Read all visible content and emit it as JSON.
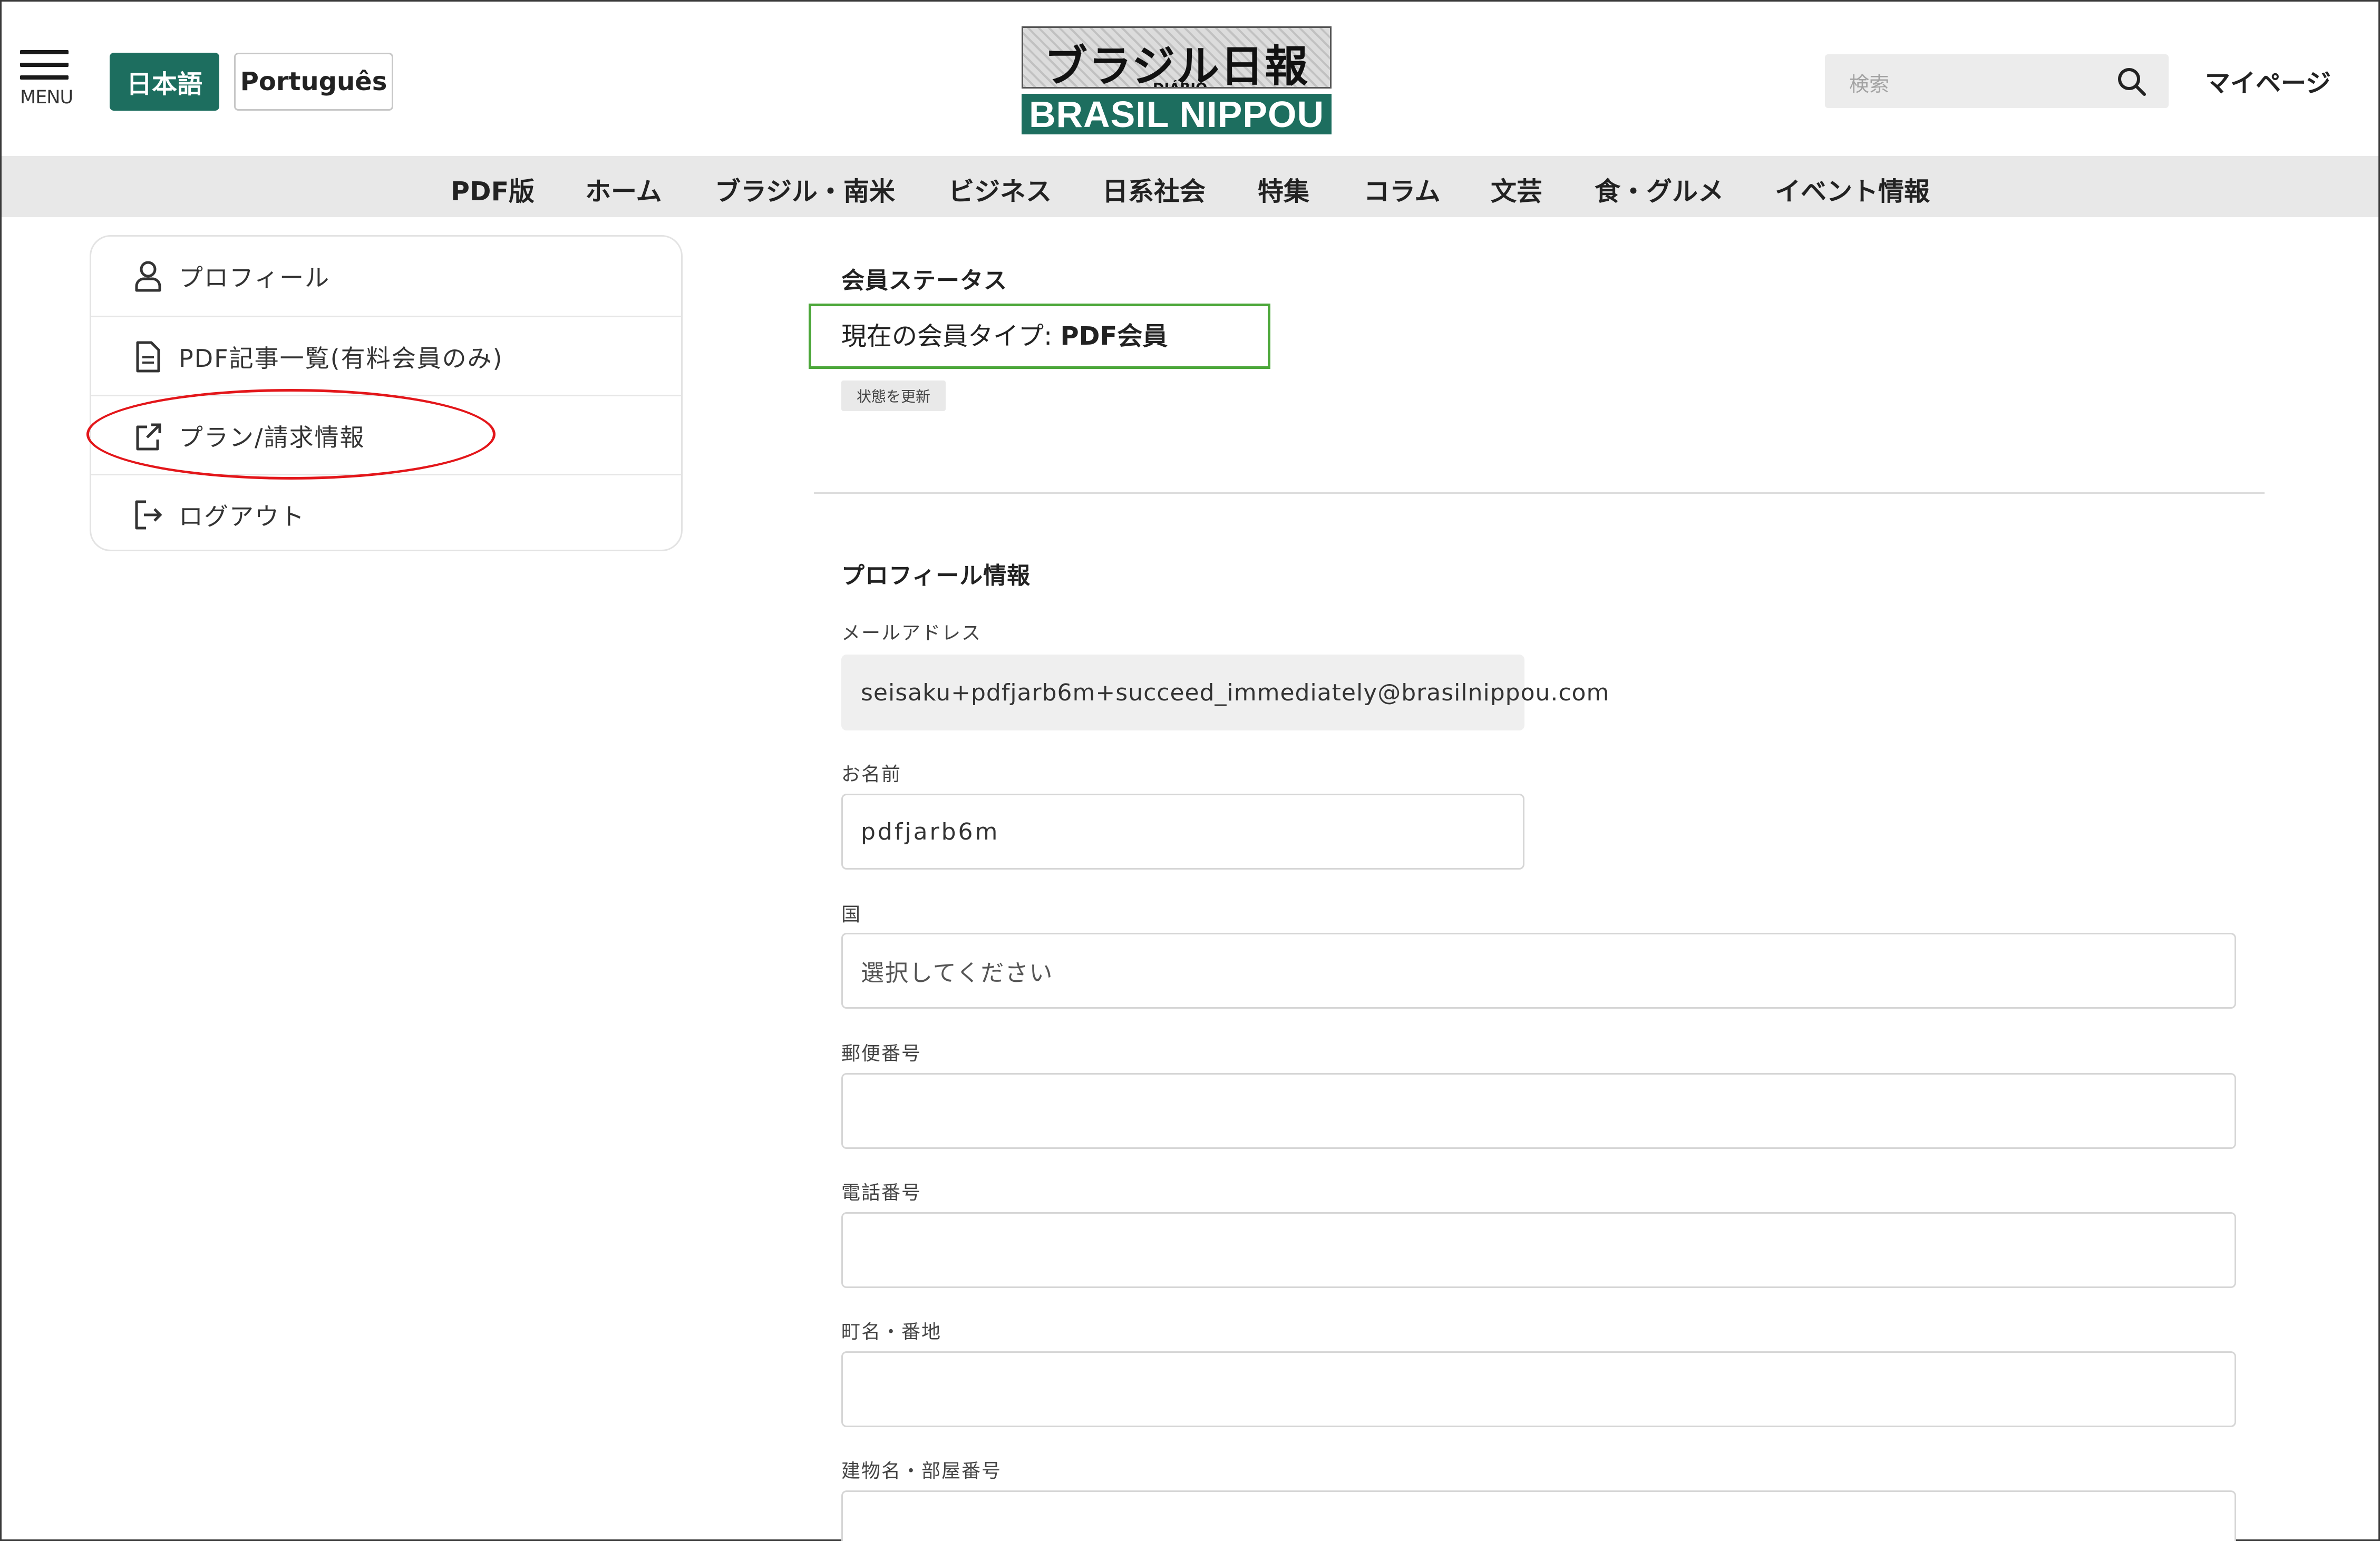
{
  "header": {
    "menu_label": "MENU",
    "lang_ja": "日本語",
    "lang_pt": "Português",
    "logo_jp": "ブラジル日報",
    "logo_diario": "DIÁRIO",
    "logo_en": "BRASIL NIPPOU",
    "search_placeholder": "検索",
    "mypage": "マイページ"
  },
  "nav": {
    "items": [
      "PDF版",
      "ホーム",
      "ブラジル・南米",
      "ビジネス",
      "日系社会",
      "特集",
      "コラム",
      "文芸",
      "食・グルメ",
      "イベント情報"
    ]
  },
  "sidebar": {
    "items": [
      {
        "label": "プロフィール",
        "icon": "user-icon"
      },
      {
        "label": "PDF記事一覧(有料会員のみ)",
        "icon": "document-icon"
      },
      {
        "label": "プラン/請求情報",
        "icon": "external-link-icon"
      },
      {
        "label": "ログアウト",
        "icon": "logout-icon"
      }
    ]
  },
  "status": {
    "title": "会員ステータス",
    "member_prefix": "現在の会員タイプ: ",
    "member_type": "PDF会員",
    "refresh_label": "状態を更新"
  },
  "profile": {
    "title": "プロフィール情報",
    "email_label": "メールアドレス",
    "email_value": "seisaku+pdfjarb6m+succeed_immediately@brasilnippou.com",
    "name_label": "お名前",
    "name_value": "pdfjarb6m",
    "country_label": "国",
    "country_value": "選択してください",
    "zip_label": "郵便番号",
    "zip_value": "",
    "phone_label": "電話番号",
    "phone_value": "",
    "address_label": "町名・番地",
    "address_value": "",
    "building_label": "建物名・部屋番号",
    "building_value": ""
  },
  "colors": {
    "brand_green": "#1d6e5f",
    "annotation_red": "#e3161a",
    "annotation_green": "#4ca73a"
  }
}
